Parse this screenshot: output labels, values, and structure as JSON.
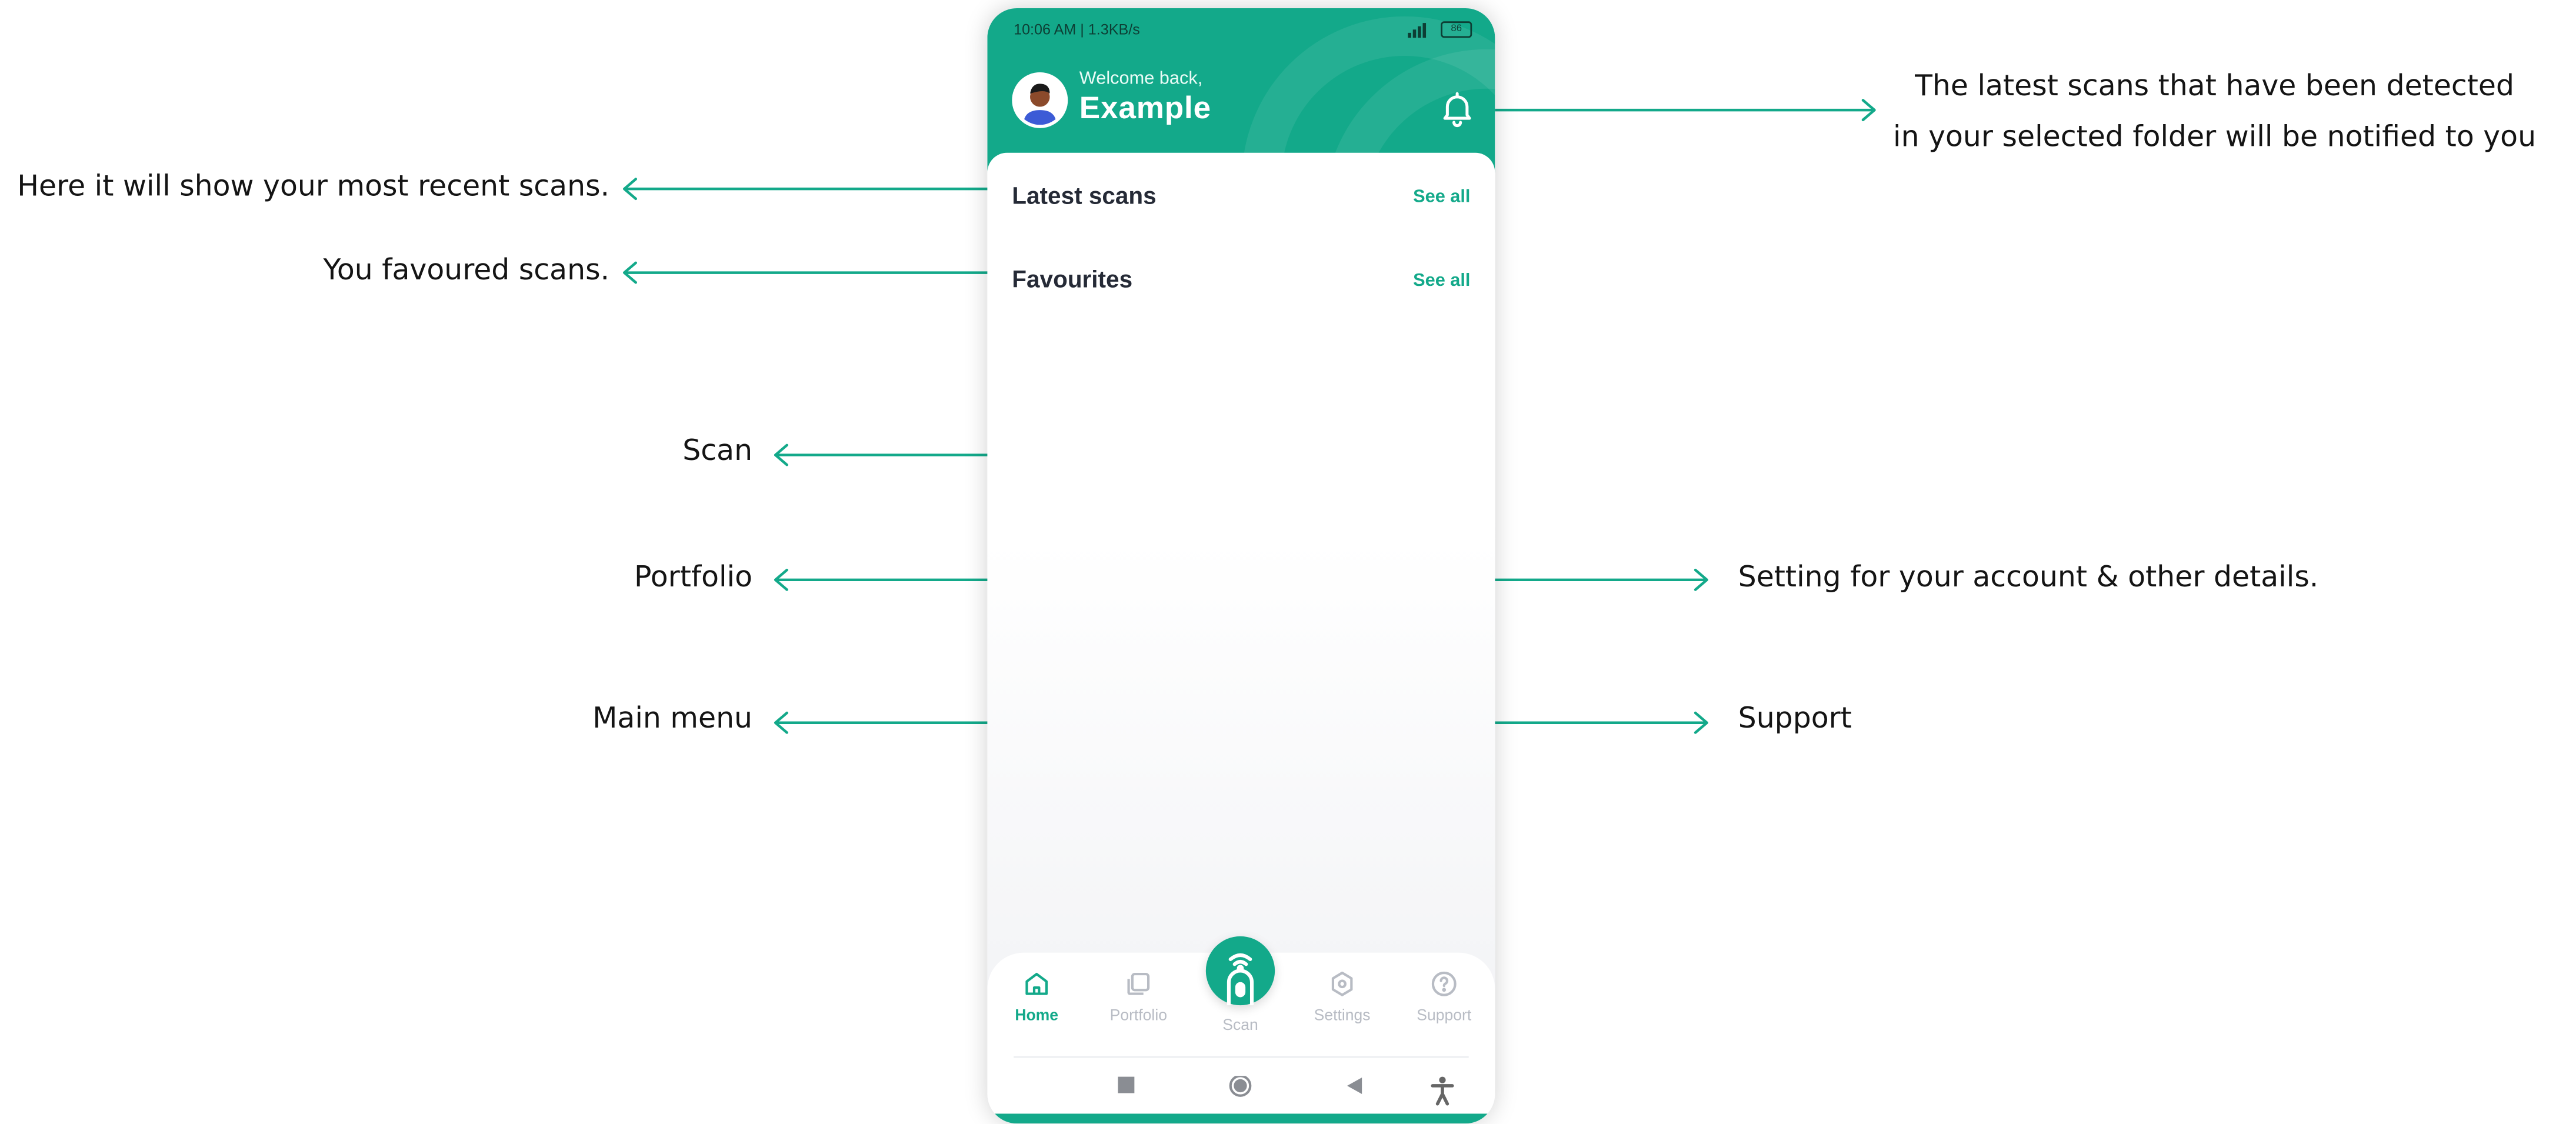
{
  "status_bar": {
    "time": "10:06 AM | 1.3KB/s",
    "battery": "86"
  },
  "header": {
    "greeting": "Welcome back,",
    "user_name": "Example"
  },
  "sections": {
    "latest_title": "Latest scans",
    "latest_link": "See all",
    "favourites_title": "Favourites",
    "favourites_link": "See all"
  },
  "nav": {
    "home": "Home",
    "portfolio": "Portfolio",
    "scan": "Scan",
    "settings": "Settings",
    "support": "Support"
  },
  "annotations": {
    "notifications_line1": "The latest scans that have been detected",
    "notifications_line2": "in your selected folder will be notified to you",
    "latest_scans": "Here it will show your most recent scans.",
    "favourites": "You favoured scans.",
    "scan": "Scan",
    "portfolio": "Portfolio",
    "main_menu": "Main menu",
    "settings": "Setting for your account & other details.",
    "support": "Support"
  },
  "icons": {
    "bell": "bell-icon",
    "home": "home-icon",
    "portfolio": "portfolio-icon",
    "scan": "scan-icon",
    "settings": "settings-icon",
    "support": "help-icon",
    "sys_recents": "square-icon",
    "sys_home": "circle-icon",
    "sys_back": "back-triangle-icon",
    "sys_accessibility": "accessibility-icon"
  },
  "colors": {
    "brand": "#13a98a",
    "inactive": "#b8bcc4",
    "heading": "#252a36"
  }
}
